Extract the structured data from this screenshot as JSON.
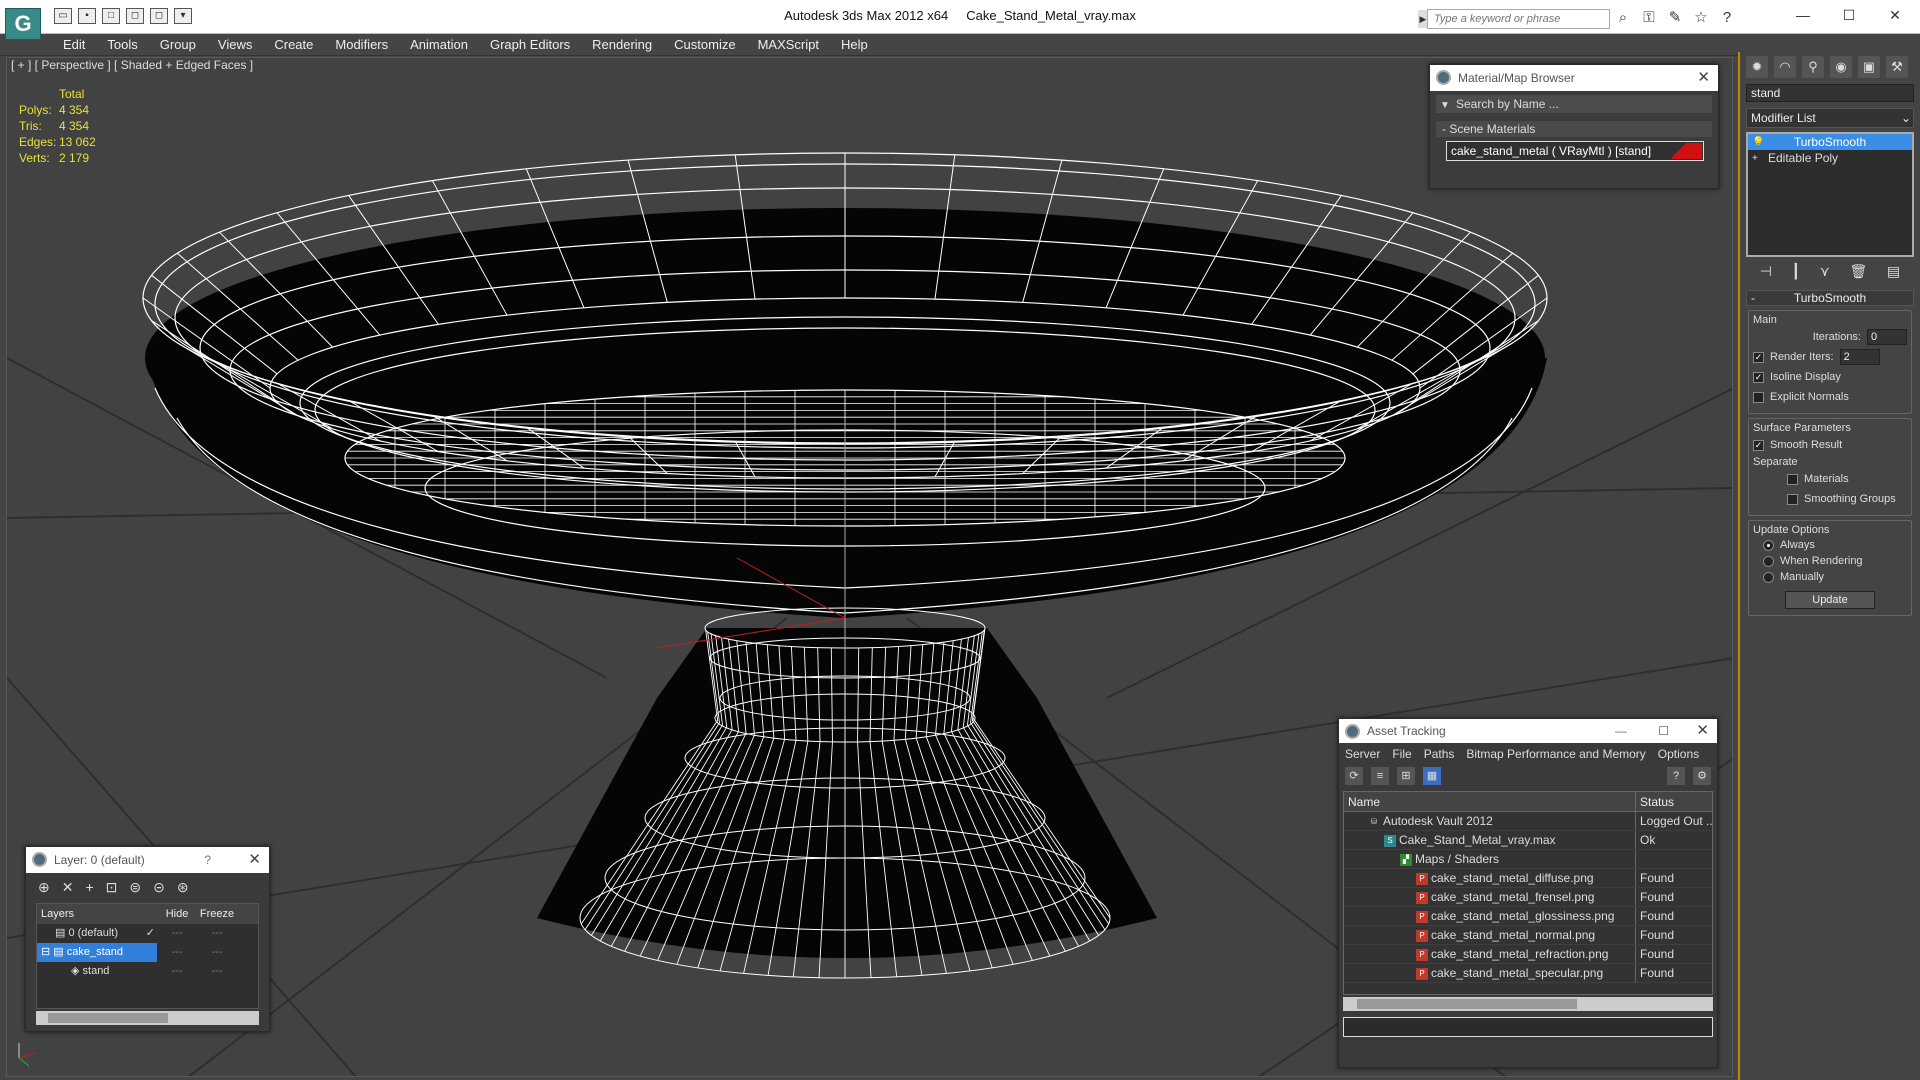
{
  "titlebar": {
    "app_title": "Autodesk 3ds Max  2012 x64",
    "file_name": "Cake_Stand_Metal_vray.max",
    "search_placeholder": "Type a keyword or phrase"
  },
  "menu": [
    "Edit",
    "Tools",
    "Group",
    "Views",
    "Create",
    "Modifiers",
    "Animation",
    "Graph Editors",
    "Rendering",
    "Customize",
    "MAXScript",
    "Help"
  ],
  "viewport": {
    "label": "[ + ] [ Perspective ] [ Shaded + Edged Faces ]",
    "stats": {
      "header": "Total",
      "polys_label": "Polys:",
      "polys": "4 354",
      "tris_label": "Tris:",
      "tris": "4 354",
      "edges_label": "Edges:",
      "edges": "13 062",
      "verts_label": "Verts:",
      "verts": "2 179"
    }
  },
  "material_browser": {
    "title": "Material/Map Browser",
    "search_placeholder": "Search by Name ...",
    "group": "- Scene Materials",
    "material": "cake_stand_metal  ( VRayMtl )  [stand]",
    "swatch_color": "#d21010"
  },
  "command_panel": {
    "object_name": "stand",
    "modifier_list": "Modifier List",
    "stack": [
      {
        "label": "TurboSmooth",
        "selected": true
      },
      {
        "label": "Editable Poly",
        "selected": false
      }
    ],
    "rollout_title": "TurboSmooth",
    "main_label": "Main",
    "iterations_label": "Iterations:",
    "iterations": "0",
    "render_iters_label": "Render Iters:",
    "render_iters": "2",
    "isoline_label": "Isoline Display",
    "explicit_normals_label": "Explicit Normals",
    "surface_params_label": "Surface Parameters",
    "smooth_result_label": "Smooth Result",
    "separate_label": "Separate",
    "materials_label": "Materials",
    "smoothing_groups_label": "Smoothing Groups",
    "update_options_label": "Update Options",
    "always_label": "Always",
    "when_rendering_label": "When Rendering",
    "manually_label": "Manually",
    "update_button": "Update"
  },
  "asset_tracking": {
    "title": "Asset Tracking",
    "menu": [
      "Server",
      "File",
      "Paths",
      "Bitmap Performance and Memory",
      "Options"
    ],
    "col_name": "Name",
    "col_status": "Status",
    "rows": [
      {
        "name": "Autodesk Vault 2012",
        "status": "Logged Out ...",
        "icon": "vault-icon"
      },
      {
        "name": "Cake_Stand_Metal_vray.max",
        "status": "Ok",
        "icon": "max-file-icon"
      },
      {
        "name": "Maps / Shaders",
        "status": "",
        "icon": "folder-icon"
      },
      {
        "name": "cake_stand_metal_diffuse.png",
        "status": "Found",
        "icon": "png-icon"
      },
      {
        "name": "cake_stand_metal_frensel.png",
        "status": "Found",
        "icon": "png-icon"
      },
      {
        "name": "cake_stand_metal_glossiness.png",
        "status": "Found",
        "icon": "png-icon"
      },
      {
        "name": "cake_stand_metal_normal.png",
        "status": "Found",
        "icon": "png-icon"
      },
      {
        "name": "cake_stand_metal_refraction.png",
        "status": "Found",
        "icon": "png-icon"
      },
      {
        "name": "cake_stand_metal_specular.png",
        "status": "Found",
        "icon": "png-icon"
      }
    ]
  },
  "layers": {
    "title": "Layer: 0 (default)",
    "help": "?",
    "col_layers": "Layers",
    "col_hide": "Hide",
    "col_freeze": "Freeze",
    "rows": [
      {
        "name": "0 (default)",
        "selected": false
      },
      {
        "name": "cake_stand",
        "selected": true
      },
      {
        "name": "stand",
        "selected": false
      }
    ]
  }
}
